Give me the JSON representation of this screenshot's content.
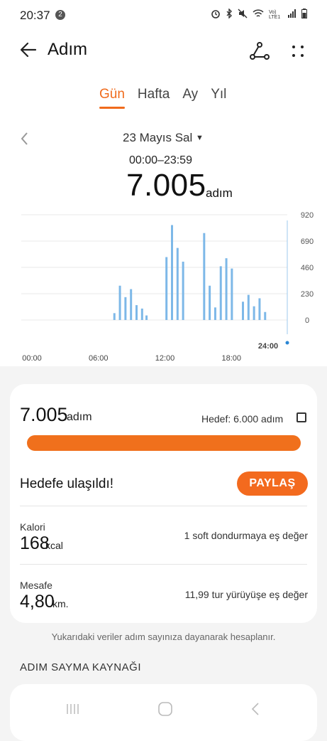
{
  "status_bar": {
    "time": "20:37",
    "notification_count": "2",
    "icons": [
      "alarm-icon",
      "bluetooth-icon",
      "mute-icon",
      "wifi-icon",
      "volte-icon",
      "signal-icon",
      "battery-icon"
    ],
    "volte_text": "Vo) LTE1"
  },
  "header": {
    "title": "Adım"
  },
  "tabs": [
    {
      "label": "Gün",
      "active": true
    },
    {
      "label": "Hafta",
      "active": false
    },
    {
      "label": "Ay",
      "active": false
    },
    {
      "label": "Yıl",
      "active": false
    }
  ],
  "date_selector": {
    "date": "23 Mayıs Sal",
    "range": "00:00–23:59"
  },
  "summary": {
    "steps": "7.005",
    "unit": "adım"
  },
  "chart_data": {
    "type": "bar",
    "x_ticks": [
      "00:00",
      "06:00",
      "12:00",
      "18:00"
    ],
    "end_label": "24:00",
    "y_ticks": [
      "920",
      "690",
      "460",
      "230",
      "0"
    ],
    "ylim": [
      0,
      920
    ],
    "xlim": [
      0,
      24
    ],
    "bar_color": "#7db8e8",
    "bars": [
      {
        "x": 8.4,
        "y": 60
      },
      {
        "x": 8.9,
        "y": 300
      },
      {
        "x": 9.4,
        "y": 200
      },
      {
        "x": 9.9,
        "y": 270
      },
      {
        "x": 10.4,
        "y": 130
      },
      {
        "x": 10.9,
        "y": 100
      },
      {
        "x": 11.3,
        "y": 40
      },
      {
        "x": 13.1,
        "y": 550
      },
      {
        "x": 13.6,
        "y": 830
      },
      {
        "x": 14.1,
        "y": 630
      },
      {
        "x": 14.6,
        "y": 510
      },
      {
        "x": 16.5,
        "y": 760
      },
      {
        "x": 17.0,
        "y": 300
      },
      {
        "x": 17.5,
        "y": 110
      },
      {
        "x": 18.0,
        "y": 470
      },
      {
        "x": 18.5,
        "y": 540
      },
      {
        "x": 19.0,
        "y": 450
      },
      {
        "x": 20.0,
        "y": 160
      },
      {
        "x": 20.5,
        "y": 220
      },
      {
        "x": 21.0,
        "y": 120
      },
      {
        "x": 21.5,
        "y": 190
      },
      {
        "x": 22.0,
        "y": 70
      }
    ]
  },
  "goal_card": {
    "steps": "7.005",
    "unit": "adım",
    "goal_text": "Hedef: 6.000 adım",
    "progress": 1.0,
    "reached_text": "Hedefe ulaşıldı!",
    "share_label": "PAYLAŞ",
    "calorie": {
      "label": "Kalori",
      "value": "168",
      "unit": "kcal",
      "equivalent": "1 soft dondurmaya eş değer"
    },
    "distance": {
      "label": "Mesafe",
      "value": "4,80",
      "unit": "km.",
      "equivalent": "11,99 tur yürüyüşe eş değer"
    }
  },
  "footnote": "Yukarıdaki veriler adım sayınıza dayanarak hesaplanır.",
  "source_section": {
    "title": "ADIM SAYMA KAYNAĞI"
  },
  "colors": {
    "accent": "#f06b1c",
    "bar": "#7db8e8",
    "background": "#f4f4f4"
  }
}
